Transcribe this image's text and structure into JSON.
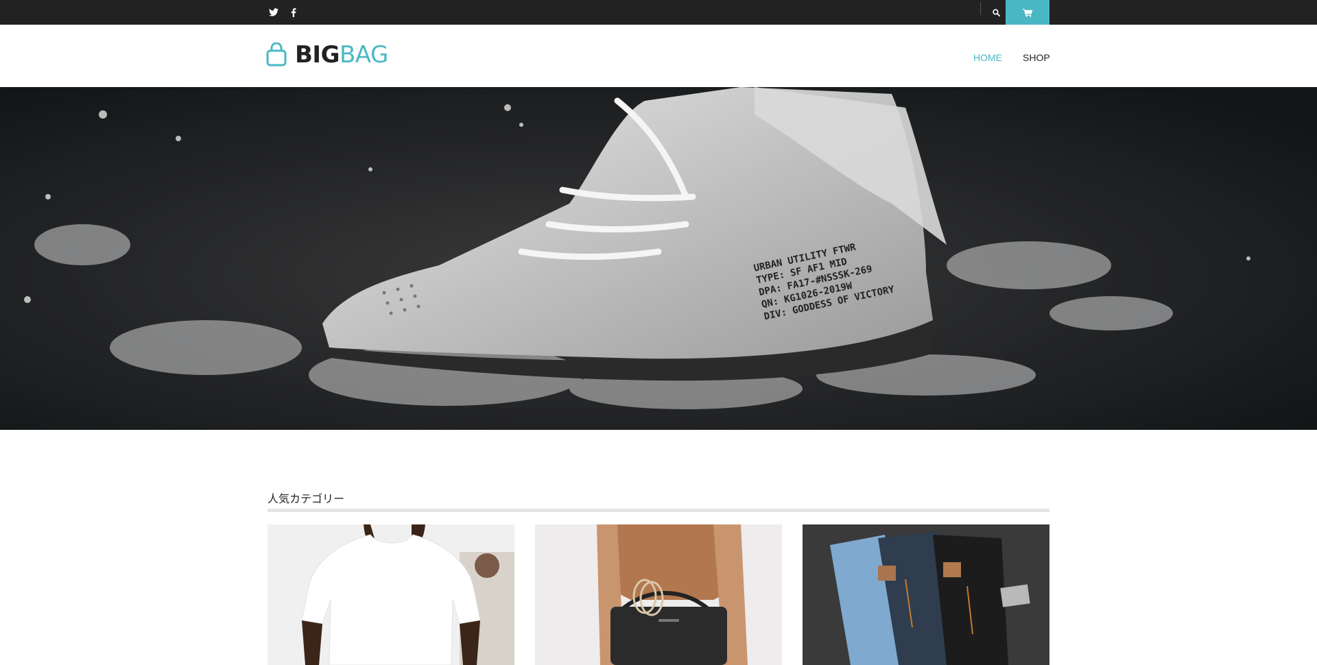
{
  "topbar": {
    "social": [
      "twitter-icon",
      "facebook-icon"
    ],
    "search_icon": "search-icon",
    "cart_icon": "cart-icon",
    "accent_color": "#4ab8c4"
  },
  "header": {
    "logo_icon": "shopping-bag-icon",
    "logo_big": "BIG",
    "logo_bag": "BAG",
    "nav": [
      {
        "label": "HOME",
        "active": true
      },
      {
        "label": "SHOP",
        "active": false
      }
    ]
  },
  "hero": {
    "image": "sneaker-splash-photo",
    "print_lines": [
      "URBAN UTILITY FTWR",
      "TYPE: SF AF1 MID",
      "DPA: FA17-#NSSSK-269",
      "QN: KG1026-2019W",
      "DIV: GODDESS OF VICTORY"
    ]
  },
  "popular": {
    "title": "人気カテゴリー",
    "cards": [
      {
        "image": "white-tshirt-photo"
      },
      {
        "image": "handbag-photo"
      },
      {
        "image": "jeans-photo"
      }
    ]
  }
}
